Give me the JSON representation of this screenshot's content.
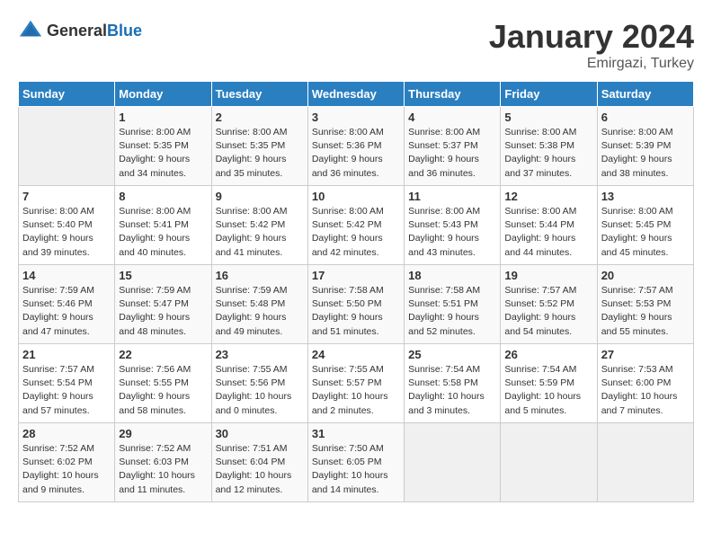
{
  "header": {
    "logo_general": "General",
    "logo_blue": "Blue",
    "month": "January 2024",
    "location": "Emirgazi, Turkey"
  },
  "weekdays": [
    "Sunday",
    "Monday",
    "Tuesday",
    "Wednesday",
    "Thursday",
    "Friday",
    "Saturday"
  ],
  "weeks": [
    [
      {
        "day": "",
        "empty": true
      },
      {
        "day": "1",
        "sunrise": "Sunrise: 8:00 AM",
        "sunset": "Sunset: 5:35 PM",
        "daylight": "Daylight: 9 hours and 34 minutes."
      },
      {
        "day": "2",
        "sunrise": "Sunrise: 8:00 AM",
        "sunset": "Sunset: 5:35 PM",
        "daylight": "Daylight: 9 hours and 35 minutes."
      },
      {
        "day": "3",
        "sunrise": "Sunrise: 8:00 AM",
        "sunset": "Sunset: 5:36 PM",
        "daylight": "Daylight: 9 hours and 36 minutes."
      },
      {
        "day": "4",
        "sunrise": "Sunrise: 8:00 AM",
        "sunset": "Sunset: 5:37 PM",
        "daylight": "Daylight: 9 hours and 36 minutes."
      },
      {
        "day": "5",
        "sunrise": "Sunrise: 8:00 AM",
        "sunset": "Sunset: 5:38 PM",
        "daylight": "Daylight: 9 hours and 37 minutes."
      },
      {
        "day": "6",
        "sunrise": "Sunrise: 8:00 AM",
        "sunset": "Sunset: 5:39 PM",
        "daylight": "Daylight: 9 hours and 38 minutes."
      }
    ],
    [
      {
        "day": "7",
        "sunrise": "Sunrise: 8:00 AM",
        "sunset": "Sunset: 5:40 PM",
        "daylight": "Daylight: 9 hours and 39 minutes."
      },
      {
        "day": "8",
        "sunrise": "Sunrise: 8:00 AM",
        "sunset": "Sunset: 5:41 PM",
        "daylight": "Daylight: 9 hours and 40 minutes."
      },
      {
        "day": "9",
        "sunrise": "Sunrise: 8:00 AM",
        "sunset": "Sunset: 5:42 PM",
        "daylight": "Daylight: 9 hours and 41 minutes."
      },
      {
        "day": "10",
        "sunrise": "Sunrise: 8:00 AM",
        "sunset": "Sunset: 5:42 PM",
        "daylight": "Daylight: 9 hours and 42 minutes."
      },
      {
        "day": "11",
        "sunrise": "Sunrise: 8:00 AM",
        "sunset": "Sunset: 5:43 PM",
        "daylight": "Daylight: 9 hours and 43 minutes."
      },
      {
        "day": "12",
        "sunrise": "Sunrise: 8:00 AM",
        "sunset": "Sunset: 5:44 PM",
        "daylight": "Daylight: 9 hours and 44 minutes."
      },
      {
        "day": "13",
        "sunrise": "Sunrise: 8:00 AM",
        "sunset": "Sunset: 5:45 PM",
        "daylight": "Daylight: 9 hours and 45 minutes."
      }
    ],
    [
      {
        "day": "14",
        "sunrise": "Sunrise: 7:59 AM",
        "sunset": "Sunset: 5:46 PM",
        "daylight": "Daylight: 9 hours and 47 minutes."
      },
      {
        "day": "15",
        "sunrise": "Sunrise: 7:59 AM",
        "sunset": "Sunset: 5:47 PM",
        "daylight": "Daylight: 9 hours and 48 minutes."
      },
      {
        "day": "16",
        "sunrise": "Sunrise: 7:59 AM",
        "sunset": "Sunset: 5:48 PM",
        "daylight": "Daylight: 9 hours and 49 minutes."
      },
      {
        "day": "17",
        "sunrise": "Sunrise: 7:58 AM",
        "sunset": "Sunset: 5:50 PM",
        "daylight": "Daylight: 9 hours and 51 minutes."
      },
      {
        "day": "18",
        "sunrise": "Sunrise: 7:58 AM",
        "sunset": "Sunset: 5:51 PM",
        "daylight": "Daylight: 9 hours and 52 minutes."
      },
      {
        "day": "19",
        "sunrise": "Sunrise: 7:57 AM",
        "sunset": "Sunset: 5:52 PM",
        "daylight": "Daylight: 9 hours and 54 minutes."
      },
      {
        "day": "20",
        "sunrise": "Sunrise: 7:57 AM",
        "sunset": "Sunset: 5:53 PM",
        "daylight": "Daylight: 9 hours and 55 minutes."
      }
    ],
    [
      {
        "day": "21",
        "sunrise": "Sunrise: 7:57 AM",
        "sunset": "Sunset: 5:54 PM",
        "daylight": "Daylight: 9 hours and 57 minutes."
      },
      {
        "day": "22",
        "sunrise": "Sunrise: 7:56 AM",
        "sunset": "Sunset: 5:55 PM",
        "daylight": "Daylight: 9 hours and 58 minutes."
      },
      {
        "day": "23",
        "sunrise": "Sunrise: 7:55 AM",
        "sunset": "Sunset: 5:56 PM",
        "daylight": "Daylight: 10 hours and 0 minutes."
      },
      {
        "day": "24",
        "sunrise": "Sunrise: 7:55 AM",
        "sunset": "Sunset: 5:57 PM",
        "daylight": "Daylight: 10 hours and 2 minutes."
      },
      {
        "day": "25",
        "sunrise": "Sunrise: 7:54 AM",
        "sunset": "Sunset: 5:58 PM",
        "daylight": "Daylight: 10 hours and 3 minutes."
      },
      {
        "day": "26",
        "sunrise": "Sunrise: 7:54 AM",
        "sunset": "Sunset: 5:59 PM",
        "daylight": "Daylight: 10 hours and 5 minutes."
      },
      {
        "day": "27",
        "sunrise": "Sunrise: 7:53 AM",
        "sunset": "Sunset: 6:00 PM",
        "daylight": "Daylight: 10 hours and 7 minutes."
      }
    ],
    [
      {
        "day": "28",
        "sunrise": "Sunrise: 7:52 AM",
        "sunset": "Sunset: 6:02 PM",
        "daylight": "Daylight: 10 hours and 9 minutes."
      },
      {
        "day": "29",
        "sunrise": "Sunrise: 7:52 AM",
        "sunset": "Sunset: 6:03 PM",
        "daylight": "Daylight: 10 hours and 11 minutes."
      },
      {
        "day": "30",
        "sunrise": "Sunrise: 7:51 AM",
        "sunset": "Sunset: 6:04 PM",
        "daylight": "Daylight: 10 hours and 12 minutes."
      },
      {
        "day": "31",
        "sunrise": "Sunrise: 7:50 AM",
        "sunset": "Sunset: 6:05 PM",
        "daylight": "Daylight: 10 hours and 14 minutes."
      },
      {
        "day": "",
        "empty": true
      },
      {
        "day": "",
        "empty": true
      },
      {
        "day": "",
        "empty": true
      }
    ]
  ]
}
